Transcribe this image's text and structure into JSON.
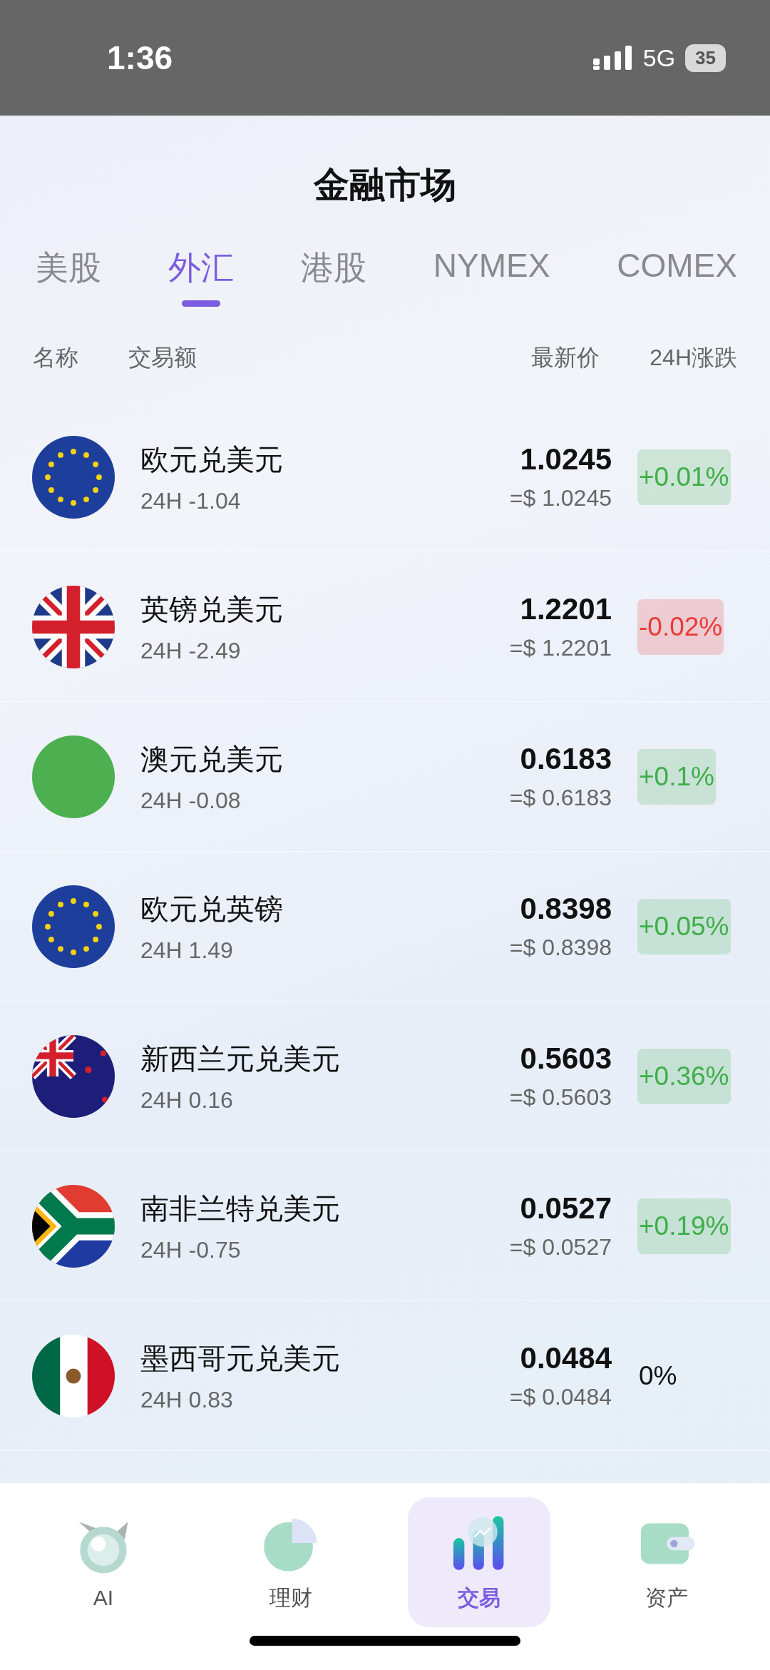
{
  "status_bar": {
    "time": "1:36",
    "network": "5G",
    "battery": "35"
  },
  "title": "金融市场",
  "tabs": [
    {
      "label": "美股",
      "selected": false
    },
    {
      "label": "外汇",
      "selected": true
    },
    {
      "label": "港股",
      "selected": false
    },
    {
      "label": "NYMEX",
      "selected": false
    },
    {
      "label": "COMEX",
      "selected": false
    }
  ],
  "columns": {
    "name": "名称",
    "volume": "交易额",
    "price": "最新价",
    "change": "24H涨跌"
  },
  "rows": [
    {
      "kind": "eu",
      "name": "欧元兑美元",
      "sub": "24H -1.04",
      "price": "1.0245",
      "usd": "=$ 1.0245",
      "change": "+0.01%",
      "color": "#3fae49"
    },
    {
      "kind": "uk",
      "name": "英镑兑美元",
      "sub": "24H -2.49",
      "price": "1.2201",
      "usd": "=$ 1.2201",
      "change": "-0.02%",
      "color": "#ea3b35"
    },
    {
      "kind": "plain",
      "name": "澳元兑美元",
      "sub": "24H -0.08",
      "price": "0.6183",
      "usd": "=$ 0.6183",
      "change": "+0.1%",
      "color": "#3fae49"
    },
    {
      "kind": "eu",
      "name": "欧元兑英镑",
      "sub": "24H 1.49",
      "price": "0.8398",
      "usd": "=$ 0.8398",
      "change": "+0.05%",
      "color": "#3fae49"
    },
    {
      "kind": "nz",
      "name": "新西兰元兑美元",
      "sub": "24H 0.16",
      "price": "0.5603",
      "usd": "=$ 0.5603",
      "change": "+0.36%",
      "color": "#3fae49"
    },
    {
      "kind": "za",
      "name": "南非兰特兑美元",
      "sub": "24H -0.75",
      "price": "0.0527",
      "usd": "=$ 0.0527",
      "change": "+0.19%",
      "color": "#3fae49"
    },
    {
      "kind": "mx",
      "name": "墨西哥元兑美元",
      "sub": "24H 0.83",
      "price": "0.0484",
      "usd": "=$ 0.0484",
      "change": "0%"
    }
  ],
  "nav": [
    {
      "kind": "ai",
      "label": "AI",
      "selected": false
    },
    {
      "kind": "pie",
      "label": "理财",
      "selected": false
    },
    {
      "kind": "bars",
      "label": "交易",
      "selected": true
    },
    {
      "kind": "wallet",
      "label": "资产",
      "selected": false
    }
  ]
}
